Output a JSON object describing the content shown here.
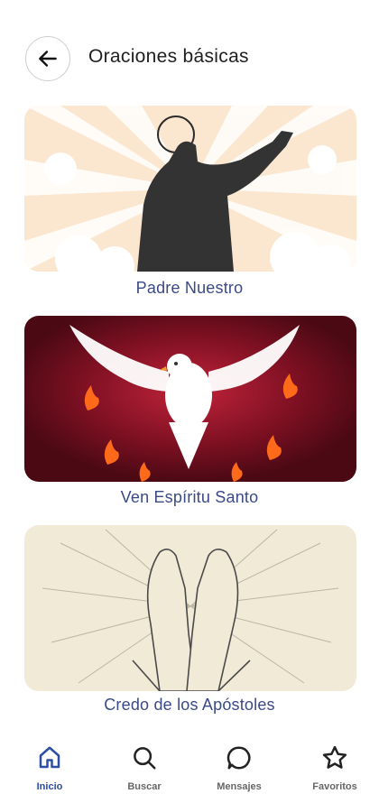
{
  "header": {
    "title": "Oraciones básicas",
    "back_icon": "arrow-left-icon"
  },
  "cards": [
    {
      "label": "Padre Nuestro",
      "image": "praying-man-silhouette"
    },
    {
      "label": "Ven Espíritu Santo",
      "image": "dove-with-flames"
    },
    {
      "label": "Credo de los Apóstoles",
      "image": "praying-hands"
    }
  ],
  "nav": {
    "items": [
      {
        "label": "Inicio",
        "icon": "home-icon",
        "active": true
      },
      {
        "label": "Buscar",
        "icon": "search-icon",
        "active": false
      },
      {
        "label": "Mensajes",
        "icon": "message-icon",
        "active": false
      },
      {
        "label": "Favoritos",
        "icon": "star-icon",
        "active": false
      }
    ]
  },
  "colors": {
    "accent": "#2b4ea6",
    "label_text": "#3b4a85",
    "card1_bg": "#fbe6cf",
    "card2_bg": "#5a0c18",
    "card3_bg": "#f1ead6"
  }
}
